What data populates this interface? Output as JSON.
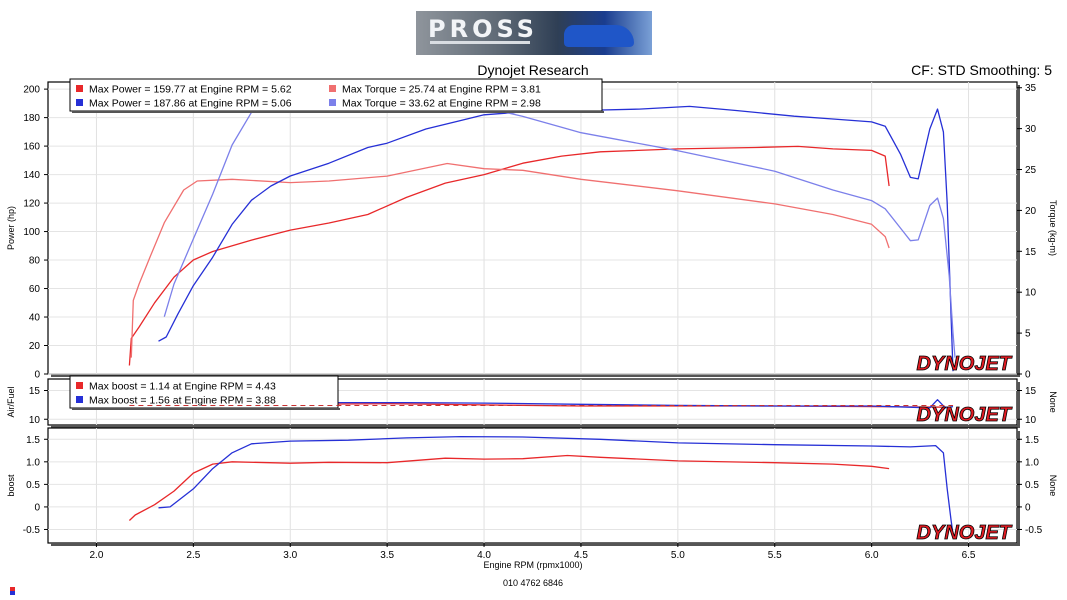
{
  "header": {
    "title": "Dynojet Research",
    "settings": "CF: STD Smoothing: 5",
    "logo_text": "PROSS"
  },
  "footer": {
    "xlabel": "Engine RPM (rpmx1000)",
    "run_id": "010 4762 6846"
  },
  "brand": "DYNOJET",
  "colors": {
    "red": "#e8282a",
    "blue": "#2630d6",
    "light_red": "#f07070",
    "light_blue": "#7c80ea"
  },
  "chart_data": [
    {
      "type": "line",
      "panel": "power_torque",
      "x_domain": [
        1.75,
        6.75
      ],
      "x_ticks": [
        "2.0",
        "2.5",
        "3.0",
        "3.5",
        "4.0",
        "4.5",
        "5.0",
        "5.5",
        "6.0",
        "6.5"
      ],
      "ylabel_left": "Power (hp)",
      "ylim_left": [
        0,
        205
      ],
      "yticks_left": [
        "0",
        "20",
        "40",
        "60",
        "80",
        "100",
        "120",
        "140",
        "160",
        "180",
        "200"
      ],
      "ylabel_right": "Torque (kg-m)",
      "ylim_right": [
        0,
        35.7
      ],
      "yticks_right": [
        "0",
        "5",
        "10",
        "15",
        "20",
        "25",
        "30",
        "35"
      ],
      "legend": [
        {
          "text": "Max Power = 159.77 at Engine RPM = 5.62",
          "color": "#e8282a"
        },
        {
          "text": "Max Torque = 25.74 at Engine RPM = 3.81",
          "color": "#f07070"
        },
        {
          "text": "Max Power = 187.86 at Engine RPM = 5.06",
          "color": "#2630d6"
        },
        {
          "text": "Max Torque = 33.62 at Engine RPM = 2.98",
          "color": "#7c80ea"
        }
      ],
      "series": [
        {
          "color": "#e8282a",
          "axis": "left",
          "points": [
            [
              2.17,
              6
            ],
            [
              2.18,
              25
            ],
            [
              2.22,
              33
            ],
            [
              2.3,
              50
            ],
            [
              2.4,
              68
            ],
            [
              2.5,
              80
            ],
            [
              2.6,
              86
            ],
            [
              2.8,
              94
            ],
            [
              3.0,
              101
            ],
            [
              3.2,
              106
            ],
            [
              3.4,
              112
            ],
            [
              3.6,
              124
            ],
            [
              3.8,
              134
            ],
            [
              4.0,
              140
            ],
            [
              4.2,
              148
            ],
            [
              4.4,
              153
            ],
            [
              4.6,
              156
            ],
            [
              5.0,
              158
            ],
            [
              5.4,
              159
            ],
            [
              5.62,
              159.77
            ],
            [
              5.8,
              158
            ],
            [
              6.0,
              157
            ],
            [
              6.07,
              153
            ],
            [
              6.09,
              132
            ]
          ]
        },
        {
          "color": "#f07070",
          "axis": "right",
          "points": [
            [
              2.18,
              2
            ],
            [
              2.19,
              9
            ],
            [
              2.22,
              11
            ],
            [
              2.28,
              14.5
            ],
            [
              2.35,
              18.5
            ],
            [
              2.45,
              22.5
            ],
            [
              2.52,
              23.6
            ],
            [
              2.7,
              23.8
            ],
            [
              3.0,
              23.4
            ],
            [
              3.2,
              23.6
            ],
            [
              3.5,
              24.2
            ],
            [
              3.81,
              25.74
            ],
            [
              4.0,
              25.1
            ],
            [
              4.2,
              24.9
            ],
            [
              4.5,
              23.8
            ],
            [
              5.0,
              22.4
            ],
            [
              5.5,
              20.8
            ],
            [
              5.8,
              19.5
            ],
            [
              6.0,
              18.3
            ],
            [
              6.07,
              16.8
            ],
            [
              6.09,
              15.4
            ]
          ]
        },
        {
          "color": "#2630d6",
          "axis": "left",
          "points": [
            [
              2.32,
              23
            ],
            [
              2.36,
              26
            ],
            [
              2.42,
              42
            ],
            [
              2.5,
              62
            ],
            [
              2.6,
              82
            ],
            [
              2.7,
              105
            ],
            [
              2.8,
              122
            ],
            [
              2.9,
              132
            ],
            [
              3.0,
              139
            ],
            [
              3.2,
              148
            ],
            [
              3.4,
              159
            ],
            [
              3.5,
              162
            ],
            [
              3.7,
              172
            ],
            [
              3.88,
              178
            ],
            [
              4.0,
              182
            ],
            [
              4.2,
              184
            ],
            [
              4.5,
              185
            ],
            [
              4.8,
              186
            ],
            [
              5.06,
              187.86
            ],
            [
              5.3,
              185
            ],
            [
              5.6,
              181
            ],
            [
              5.8,
              179
            ],
            [
              6.0,
              177
            ],
            [
              6.07,
              174
            ],
            [
              6.15,
              154
            ],
            [
              6.2,
              138
            ],
            [
              6.24,
              137
            ],
            [
              6.3,
              172
            ],
            [
              6.34,
              186
            ],
            [
              6.37,
              170
            ],
            [
              6.39,
              120
            ],
            [
              6.41,
              40
            ],
            [
              6.42,
              2
            ]
          ]
        },
        {
          "color": "#7c80ea",
          "axis": "right",
          "points": [
            [
              2.35,
              7
            ],
            [
              2.4,
              11
            ],
            [
              2.5,
              16.5
            ],
            [
              2.6,
              22
            ],
            [
              2.7,
              28
            ],
            [
              2.8,
              32
            ],
            [
              2.9,
              33.4
            ],
            [
              2.98,
              33.62
            ],
            [
              3.2,
              33.3
            ],
            [
              3.5,
              33.2
            ],
            [
              3.8,
              33.0
            ],
            [
              4.0,
              32.6
            ],
            [
              4.2,
              31.5
            ],
            [
              4.5,
              29.5
            ],
            [
              5.0,
              27.3
            ],
            [
              5.5,
              24.8
            ],
            [
              5.8,
              22.5
            ],
            [
              6.0,
              21.2
            ],
            [
              6.07,
              20.2
            ],
            [
              6.15,
              17.8
            ],
            [
              6.2,
              16.3
            ],
            [
              6.24,
              16.4
            ],
            [
              6.3,
              20.6
            ],
            [
              6.34,
              21.5
            ],
            [
              6.37,
              19
            ],
            [
              6.4,
              12
            ],
            [
              6.42,
              5
            ],
            [
              6.43,
              2
            ]
          ]
        }
      ]
    },
    {
      "type": "line",
      "panel": "air_fuel",
      "x_domain": [
        1.75,
        6.75
      ],
      "ylabel_left": "Air/Fuel",
      "ylim_left": [
        9,
        17
      ],
      "yticks_left": [
        "10",
        "15"
      ],
      "ylabel_right": "None",
      "ylim_right": [
        9,
        17
      ],
      "yticks_right": [
        "10",
        "15"
      ],
      "legend": [
        {
          "text": "Max boost = 1.14 at Engine RPM = 4.43",
          "color": "#e8282a"
        },
        {
          "text": "Max boost = 1.56 at Engine RPM = 3.88",
          "color": "#2630d6"
        }
      ],
      "series": [
        {
          "color": "#e8282a",
          "axis": "left",
          "points": [
            [
              2.17,
              12.6
            ],
            [
              2.5,
              12.6
            ],
            [
              3.0,
              12.6
            ],
            [
              3.5,
              12.7
            ],
            [
              4.0,
              12.5
            ],
            [
              4.5,
              12.3
            ],
            [
              5.0,
              12.3
            ],
            [
              5.5,
              12.3
            ],
            [
              6.0,
              12.2
            ],
            [
              6.4,
              12.1
            ]
          ]
        },
        {
          "color": "#2630d6",
          "axis": "left",
          "points": [
            [
              2.32,
              12.9
            ],
            [
              2.8,
              12.9
            ],
            [
              3.2,
              12.9
            ],
            [
              3.6,
              12.9
            ],
            [
              4.0,
              12.8
            ],
            [
              4.5,
              12.6
            ],
            [
              5.0,
              12.4
            ],
            [
              5.5,
              12.3
            ],
            [
              6.0,
              12.3
            ],
            [
              6.3,
              12.0
            ],
            [
              6.34,
              13.4
            ],
            [
              6.38,
              12.0
            ],
            [
              6.42,
              12.2
            ]
          ]
        }
      ]
    },
    {
      "type": "line",
      "panel": "boost",
      "x_domain": [
        1.75,
        6.75
      ],
      "ylabel_left": "boost",
      "ylim_left": [
        -0.8,
        1.75
      ],
      "yticks_left": [
        "-0.5",
        "0",
        "0.5",
        "1.0",
        "1.5"
      ],
      "ylabel_right": "None",
      "ylim_right": [
        -0.8,
        1.75
      ],
      "yticks_right": [
        "-0.5",
        "0",
        "0.5",
        "1.0",
        "1.5"
      ],
      "series": [
        {
          "color": "#e8282a",
          "axis": "left",
          "points": [
            [
              2.17,
              -0.3
            ],
            [
              2.2,
              -0.18
            ],
            [
              2.3,
              0.05
            ],
            [
              2.4,
              0.35
            ],
            [
              2.5,
              0.75
            ],
            [
              2.6,
              0.95
            ],
            [
              2.7,
              1.0
            ],
            [
              3.0,
              0.97
            ],
            [
              3.2,
              0.99
            ],
            [
              3.5,
              0.98
            ],
            [
              3.8,
              1.08
            ],
            [
              4.0,
              1.06
            ],
            [
              4.2,
              1.07
            ],
            [
              4.43,
              1.14
            ],
            [
              4.6,
              1.1
            ],
            [
              5.0,
              1.02
            ],
            [
              5.5,
              0.98
            ],
            [
              5.8,
              0.95
            ],
            [
              6.0,
              0.9
            ],
            [
              6.09,
              0.85
            ]
          ]
        },
        {
          "color": "#2630d6",
          "axis": "left",
          "points": [
            [
              2.32,
              -0.02
            ],
            [
              2.38,
              0.0
            ],
            [
              2.5,
              0.4
            ],
            [
              2.6,
              0.85
            ],
            [
              2.7,
              1.2
            ],
            [
              2.8,
              1.4
            ],
            [
              3.0,
              1.46
            ],
            [
              3.3,
              1.48
            ],
            [
              3.6,
              1.53
            ],
            [
              3.88,
              1.56
            ],
            [
              4.2,
              1.55
            ],
            [
              4.6,
              1.5
            ],
            [
              5.0,
              1.42
            ],
            [
              5.5,
              1.38
            ],
            [
              6.0,
              1.35
            ],
            [
              6.2,
              1.33
            ],
            [
              6.33,
              1.36
            ],
            [
              6.37,
              1.2
            ],
            [
              6.39,
              0.4
            ],
            [
              6.41,
              -0.3
            ],
            [
              6.42,
              -0.6
            ]
          ]
        }
      ]
    }
  ]
}
